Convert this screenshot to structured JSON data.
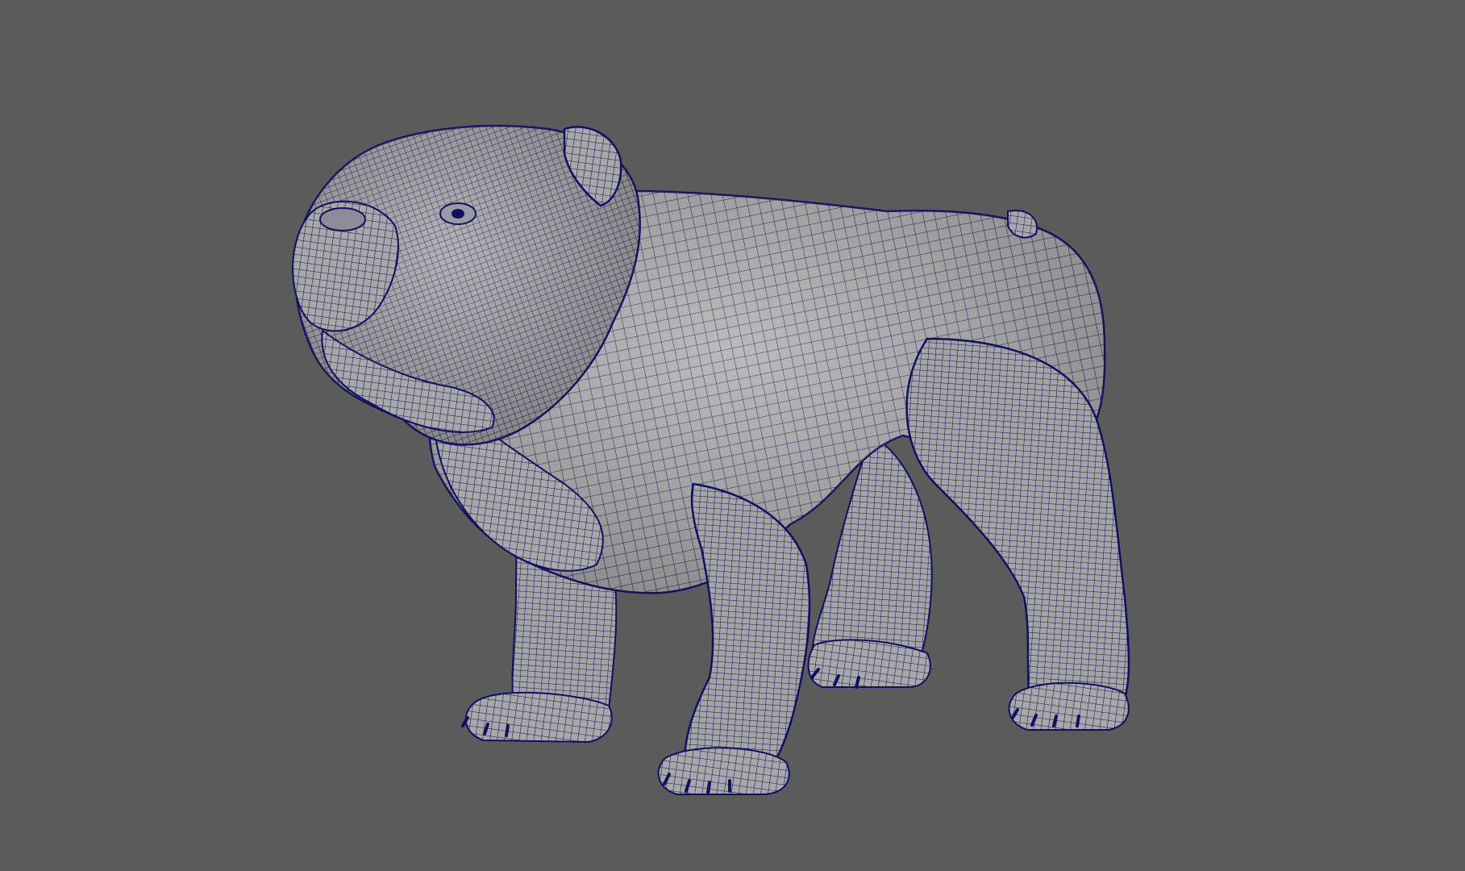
{
  "viewport": {
    "background_color": "#5b5b5b",
    "display_mode": "wireframe-on-shaded"
  },
  "model": {
    "subject": "bulldog",
    "surface_color": "#a6a6a6",
    "surface_shadow_color": "#7c7c80",
    "wire_color": "#101060"
  }
}
